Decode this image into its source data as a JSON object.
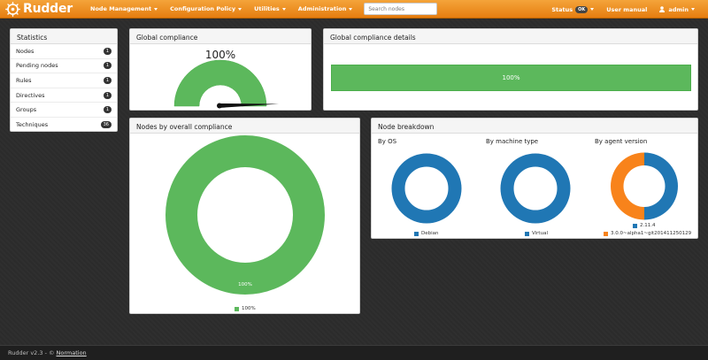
{
  "app": {
    "brand": "Rudder"
  },
  "nav": {
    "menu": [
      "Node Management",
      "Configuration Policy",
      "Utilities",
      "Administration"
    ],
    "search_placeholder": "Search nodes",
    "status_label": "Status",
    "status_badge": "OK",
    "user_manual": "User manual",
    "user": "admin"
  },
  "stats": {
    "title": "Statistics",
    "items": [
      {
        "label": "Nodes",
        "count": "1"
      },
      {
        "label": "Pending nodes",
        "count": "1"
      },
      {
        "label": "Rules",
        "count": "1"
      },
      {
        "label": "Directives",
        "count": "1"
      },
      {
        "label": "Groups",
        "count": "1"
      },
      {
        "label": "Techniques",
        "count": "36"
      }
    ]
  },
  "global_compliance": {
    "title": "Global compliance",
    "value_label": "100%",
    "value": 100
  },
  "global_details": {
    "title": "Global compliance details",
    "bar_label": "100%",
    "bar_value": 100
  },
  "nodes_overall": {
    "title": "Nodes by overall compliance",
    "slice_label": "100%",
    "legend": "100%"
  },
  "breakdown": {
    "title": "Node breakdown",
    "by_os": {
      "title": "By OS",
      "legend": "Debian"
    },
    "by_machine": {
      "title": "By machine type",
      "legend": "Virtual"
    },
    "by_agent": {
      "title": "By agent version",
      "legend": [
        "2.11.4",
        "3.0.0~alpha1~git201411250129"
      ]
    }
  },
  "colors": {
    "green": "#5cb85c",
    "blue": "#2077b4",
    "orange": "#f8831b",
    "brand": "#f08a1c"
  },
  "footer": {
    "text": "Rudder v2.3 - ©",
    "link": "Normation"
  }
}
